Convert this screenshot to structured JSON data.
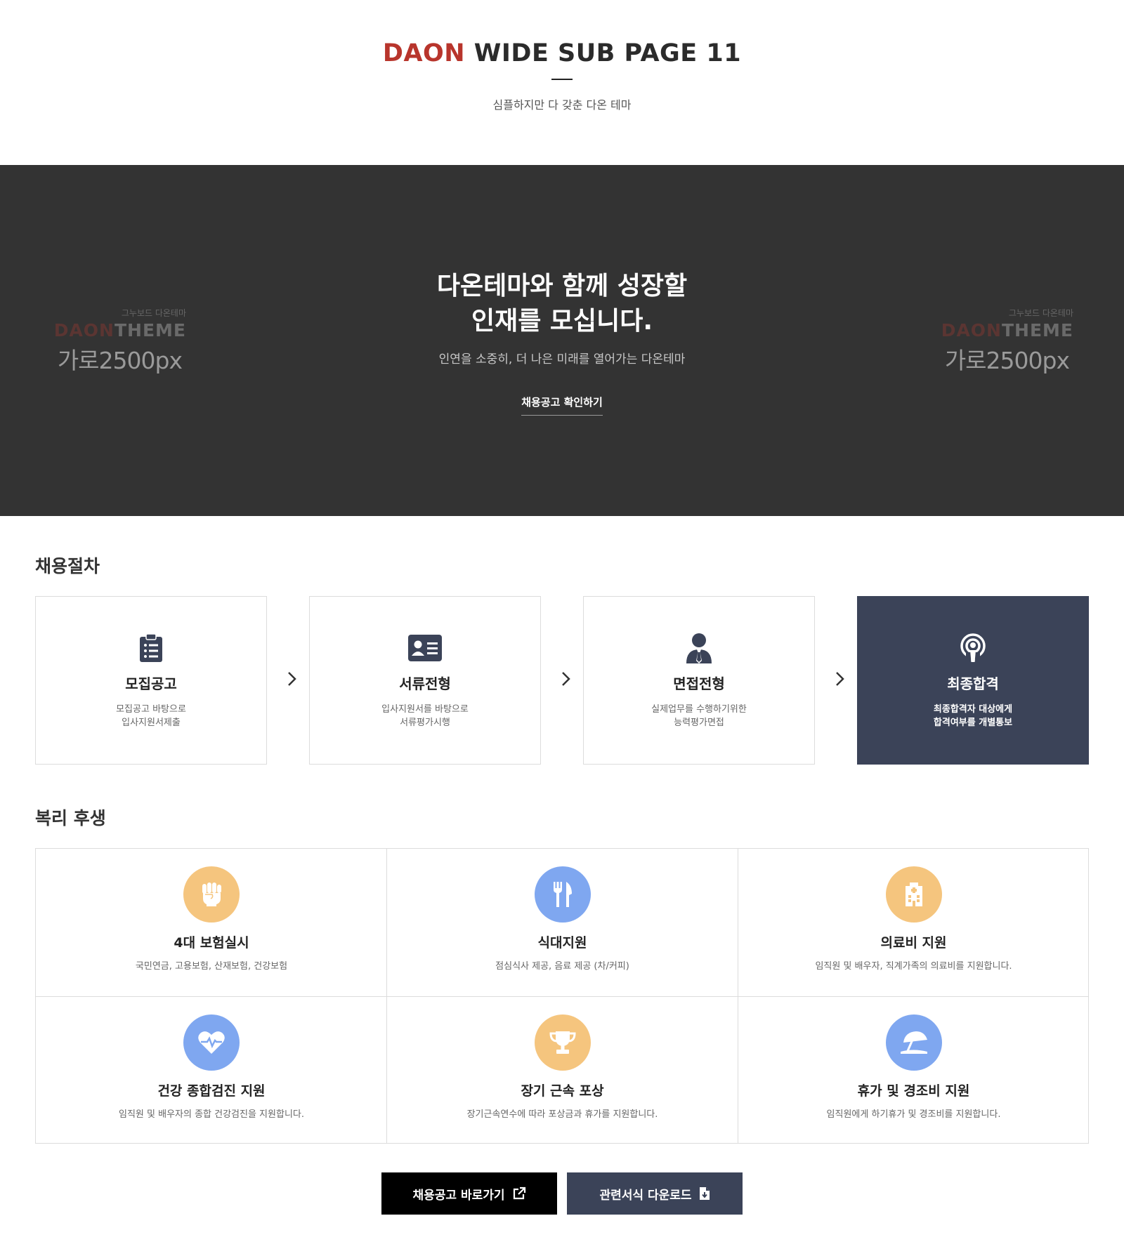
{
  "header": {
    "title_accent": "DAON",
    "title_rest": " WIDE SUB PAGE 11",
    "subtitle": "심플하지만 다 갖춘 다온 테마"
  },
  "hero": {
    "title_line1": "다온테마와 함께 성장할",
    "title_line2": "인재를 모십니다.",
    "subtitle": "인연을 소중히, 더 나은 미래를 열어가는 다온테마",
    "link_label": "채용공고 확인하기",
    "side_logo": {
      "small": "그누보드 다온테마",
      "brand_part1": "DAON",
      "brand_part2": "THEME",
      "size": "가로2500px"
    }
  },
  "process": {
    "title": "채용절차",
    "steps": [
      {
        "title": "모집공고",
        "desc1": "모집공고 바탕으로",
        "desc2": "입사지원서제출",
        "icon": "clipboard-list-icon"
      },
      {
        "title": "서류전형",
        "desc1": "입사지원서를 바탕으로",
        "desc2": "서류평가시행",
        "icon": "id-card-icon"
      },
      {
        "title": "면접전형",
        "desc1": "실제업무를 수행하기위한",
        "desc2": "능력평가면접",
        "icon": "user-tie-icon"
      },
      {
        "title": "최종합격",
        "desc1": "최종합격자 대상에게",
        "desc2": "합격여부를 개별통보",
        "icon": "podcast-icon"
      }
    ]
  },
  "welfare": {
    "title": "복리 후생",
    "items": [
      {
        "title": "4대 보험실시",
        "desc": "국민연금, 고용보험, 산재보험, 건강보험",
        "icon": "fist-icon",
        "color": "#f5c57e"
      },
      {
        "title": "식대지원",
        "desc": "점심식사 제공, 음료 제공 (차/커피)",
        "icon": "utensils-icon",
        "color": "#7fa7f0"
      },
      {
        "title": "의료비 지원",
        "desc": "임직원 및 배우자, 직계가족의 의료비를 지원합니다.",
        "icon": "hospital-icon",
        "color": "#f5c57e"
      },
      {
        "title": "건강 종합검진 지원",
        "desc": "임직원 및 배우자의 종합 건강검진을 지원합니다.",
        "icon": "heartbeat-icon",
        "color": "#7fa7f0"
      },
      {
        "title": "장기 근속 포상",
        "desc": "장기근속연수에 따라 포상금과 휴가를 지원합니다.",
        "icon": "trophy-icon",
        "color": "#f5c57e"
      },
      {
        "title": "휴가 및 경조비 지원",
        "desc": "임직원에게 하기휴가 및 경조비를 지원합니다.",
        "icon": "umbrella-beach-icon",
        "color": "#7fa7f0"
      }
    ]
  },
  "buttons": {
    "recruit_label": "채용공고 바로가기",
    "download_label": "관련서식 다운로드"
  },
  "colors": {
    "accent_red": "#b8352c",
    "hero_bg": "#333333",
    "navy": "#3b4358",
    "orange": "#f5c57e",
    "blue": "#7fa7f0"
  }
}
